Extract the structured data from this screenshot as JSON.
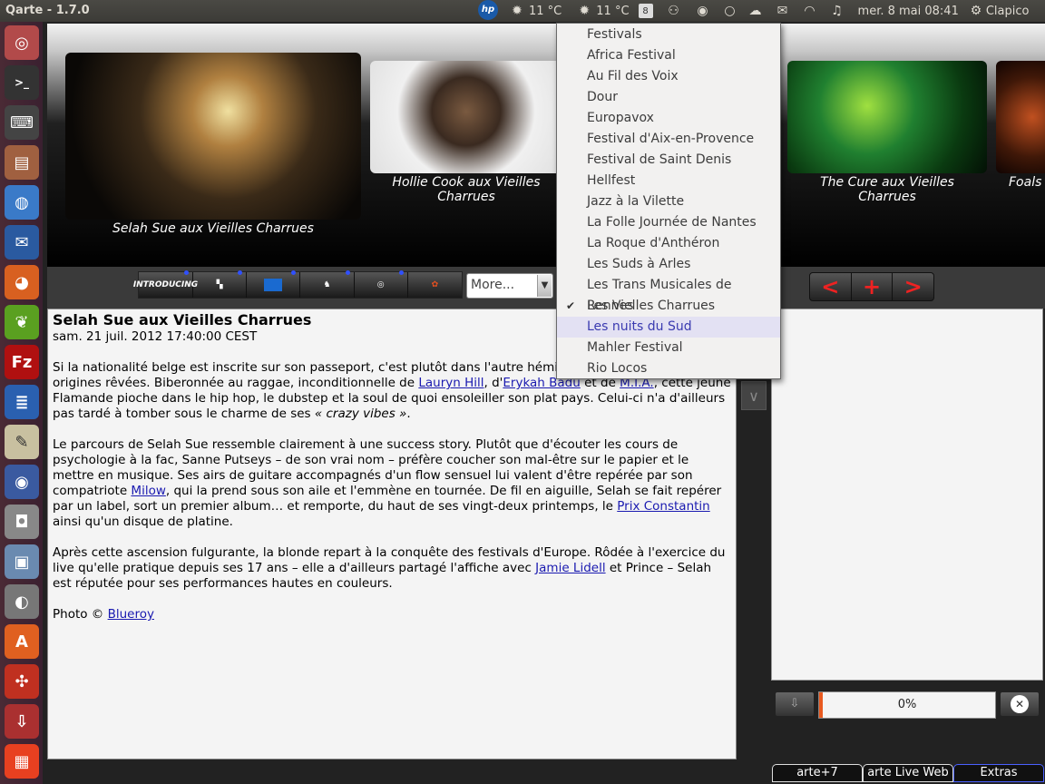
{
  "panel": {
    "app_title": "Qarte - 1.7.0",
    "weather1": "11 °C",
    "weather2": "11 °C",
    "calendar_day": "8",
    "datetime": "mer. 8 mai  08:41",
    "user": "Clapico",
    "icons": [
      "hp-icon",
      "sun-icon",
      "sun-icon",
      "calendar-icon",
      "network-icon",
      "eye-icon",
      "circle-icon",
      "cloud-icon",
      "mail-icon",
      "wifi-icon",
      "volume-icon",
      "gear-icon"
    ]
  },
  "launcher": {
    "items": [
      "ubuntu-home-icon",
      "terminal-icon",
      "terminal2-icon",
      "files-icon",
      "chromium-icon",
      "thunderbird-icon",
      "firefox-icon",
      "leaf-icon",
      "filezilla-icon",
      "document-icon",
      "text-editor-icon",
      "radio-icon",
      "camera-icon",
      "photos-icon",
      "gimp-icon",
      "software-center-icon",
      "settings-icon",
      "installer-icon",
      "arte-icon"
    ],
    "filezilla_label": "Fz",
    "software_label": "A"
  },
  "gallery": {
    "captions": [
      "Selah Sue aux Vieilles Charrues",
      "Hollie Cook aux Vieilles Charrues",
      "The Cure aux Vieilles Charrues",
      "Foals"
    ]
  },
  "toolbar": {
    "partners": [
      "INTRODUCING",
      "logo2",
      "logo3",
      "logo4",
      "logo5",
      "logo6"
    ],
    "partner1_label": "INTRODUCING",
    "more_label": "More...",
    "nav_prev": "<",
    "nav_add": "+",
    "nav_next": ">"
  },
  "dropdown": {
    "items": [
      "Festivals",
      "Africa Festival",
      "Au Fil des Voix",
      "Dour",
      "Europavox",
      "Festival d'Aix-en-Provence",
      "Festival de Saint Denis",
      "Hellfest",
      "Jazz à la Vilette",
      "La Folle Journée de Nantes",
      "La Roque d'Anthéron",
      "Les Suds à Arles",
      "Les Trans Musicales de Rennes",
      "Les Vielles Charrues",
      "Les nuits du Sud",
      "Mahler Festival",
      "Rio Locos"
    ],
    "checked": "Les Vielles Charrues",
    "hovered": "Les nuits du Sud"
  },
  "article": {
    "title": "Selah Sue aux Vieilles Charrues",
    "date": "sam. 21 juil. 2012 17:40:00 CEST",
    "p1_a": "Si la nationalité belge est inscrite sur son passeport, c'est plutôt dans l'autre hémisp",
    "p1_b": "origines rêvées. Biberonnée au raggae, inconditionnelle de ",
    "link_lauryn": "Lauryn Hill",
    "p1_c": ", d'",
    "link_erykah": "Erykah Badu",
    "p1_d": " et de ",
    "link_mia": "M.I.A.",
    "p1_e": ", cette jeune Flamande pioche dans le hip hop, le dubstep et la soul de quoi ensoleiller son plat pays. Celui-ci n'a d'ailleurs pas tardé à tomber sous le charme de ses ",
    "p1_f": "« crazy vibes »",
    "p1_g": ".",
    "p2_a": "Le parcours de Selah Sue ressemble clairement à une success story. Plutôt que d'écouter les cours de psychologie à la fac, Sanne Putseys – de son vrai nom – préfère coucher son mal-être sur le papier et le mettre en musique. Ses airs de guitare accompagnés d'un flow sensuel lui valent d'être repérée par son compatriote ",
    "link_milow": "Milow",
    "p2_b": ", qui la prend sous son aile et l'emmène en tournée. De fil en aiguille, Selah se fait repérer par un label, sort un premier album… et remporte, du haut de ses vingt-deux printemps, le ",
    "link_prix": "Prix Constantin",
    "p2_c": " ainsi qu'un disque de platine.",
    "p3_a": "Après cette ascension fulgurante, la blonde repart à la conquête des festivals d'Europe. Rôdée à l'exercice du live qu'elle pratique depuis ses 17 ans – elle a d'ailleurs partagé l'affiche avec ",
    "link_jamie": "Jamie Lidell",
    "p3_b": " et Prince – Selah est réputée pour ses performances hautes en couleurs.",
    "p4_a": "Photo © ",
    "link_blueroy": "Blueroy"
  },
  "download": {
    "progress_text": "0%",
    "progress_value": 0,
    "scroll_glyph": "∨",
    "cancel_glyph": "✕",
    "download_glyph": "⇩"
  },
  "bottom_tabs": [
    "arte+7",
    "arte Live Web",
    "Extras"
  ],
  "colors": {
    "accent_red": "#e22222",
    "link_blue": "#1a1ab0",
    "menu_hover": "#e3e1f3",
    "progress_orange": "#e85a20"
  }
}
